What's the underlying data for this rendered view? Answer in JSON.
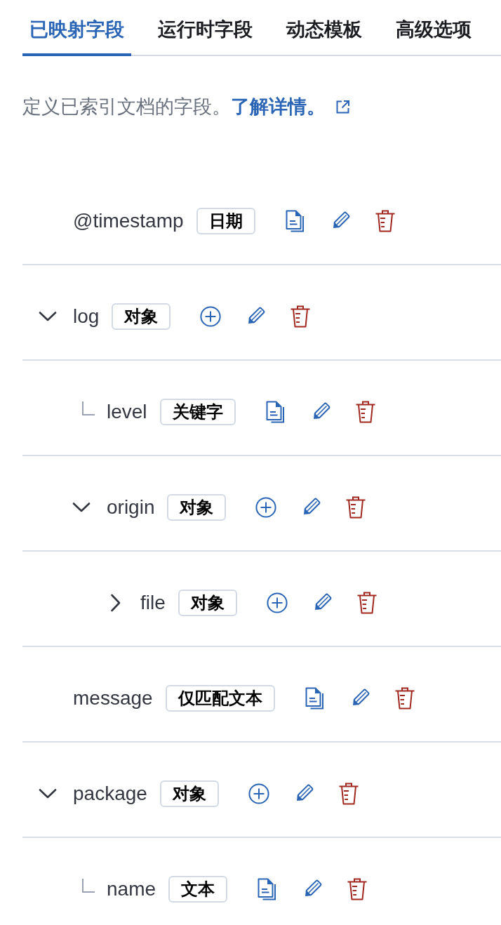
{
  "tabs": [
    {
      "label": "已映射字段",
      "selected": true
    },
    {
      "label": "运行时字段",
      "selected": false
    },
    {
      "label": "动态模板",
      "selected": false
    },
    {
      "label": "高级选项",
      "selected": false
    }
  ],
  "description": {
    "text": "定义已索引文档的字段。",
    "link": "了解详情。"
  },
  "fields": [
    {
      "name": "@timestamp",
      "data_type": "日期",
      "kind": "field"
    },
    {
      "name": "log",
      "data_type": "对象",
      "kind": "object",
      "expanded": true,
      "children": [
        {
          "name": "level",
          "data_type": "关键字",
          "kind": "field"
        },
        {
          "name": "origin",
          "data_type": "对象",
          "kind": "object",
          "expanded": true,
          "children": [
            {
              "name": "file",
              "data_type": "对象",
              "kind": "object",
              "expanded": false
            }
          ]
        }
      ]
    },
    {
      "name": "message",
      "data_type": "仅匹配文本",
      "kind": "field"
    },
    {
      "name": "package",
      "data_type": "对象",
      "kind": "object",
      "expanded": true,
      "children": [
        {
          "name": "name",
          "data_type": "文本",
          "kind": "field"
        }
      ]
    }
  ]
}
